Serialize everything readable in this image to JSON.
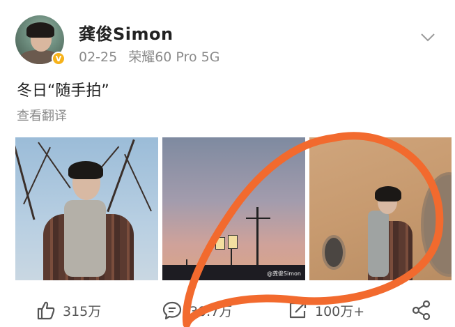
{
  "post": {
    "author": {
      "name": "龚俊Simon",
      "verified_badge": "V",
      "badge_color": "#f6b21a"
    },
    "meta": {
      "date": "02-25",
      "device": "荣耀60 Pro 5G"
    },
    "menu_icon": "chevron-down-icon",
    "text": "冬日“随手拍”",
    "translate_label": "查看翻译",
    "images": [
      {
        "name": "photo-tree-portrait"
      },
      {
        "name": "photo-sunset-lights",
        "watermark": "@龚俊Simon"
      },
      {
        "name": "photo-wall-side"
      }
    ]
  },
  "actions": {
    "like": {
      "icon": "thumbs-up-icon",
      "count": "315万"
    },
    "comment": {
      "icon": "comment-icon",
      "count": "30.7万"
    },
    "repost": {
      "icon": "repost-icon",
      "count": "100万+"
    },
    "share": {
      "icon": "share-icon"
    }
  },
  "annotation": {
    "color": "#f26a2e"
  }
}
